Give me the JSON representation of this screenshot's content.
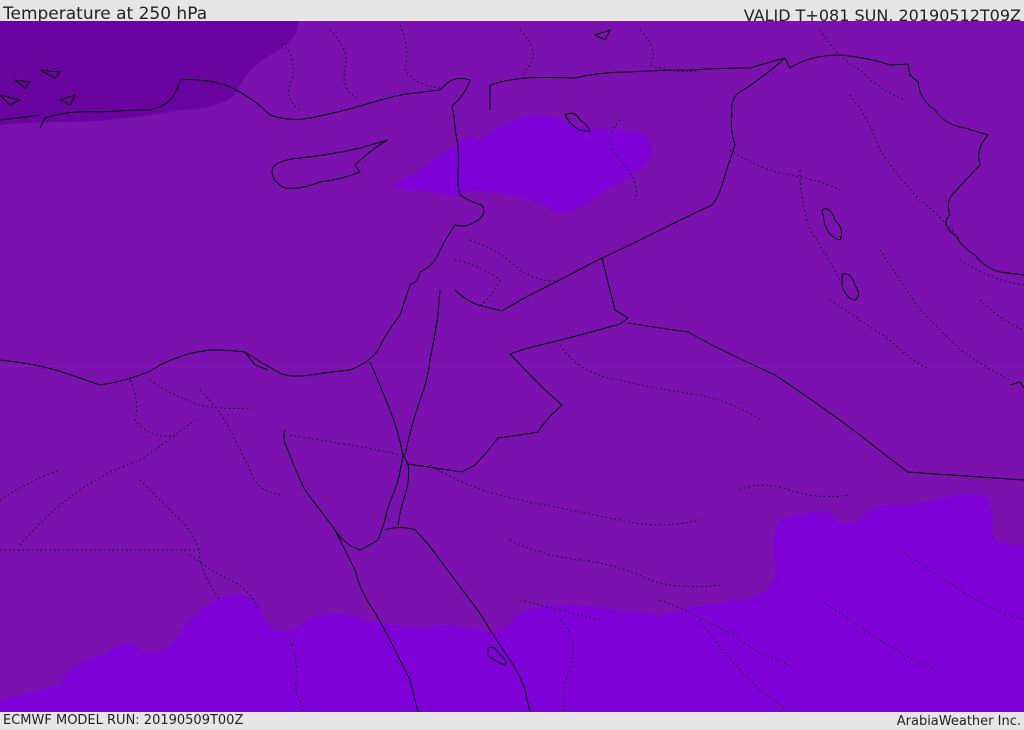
{
  "header": {
    "title": "Temperature at 250 hPa",
    "valid": "VALID T+081 SUN, 20190512T09Z"
  },
  "footer": {
    "model_run": "ECMWF MODEL RUN: 20190509T00Z",
    "credit": "ArabiaWeather Inc."
  },
  "colors": {
    "base_field": "#7b12b0",
    "cold_field": "#6a04a0",
    "warm_field": "#7e02d8",
    "borders": "#000000",
    "frame": "#e6e6e6"
  }
}
